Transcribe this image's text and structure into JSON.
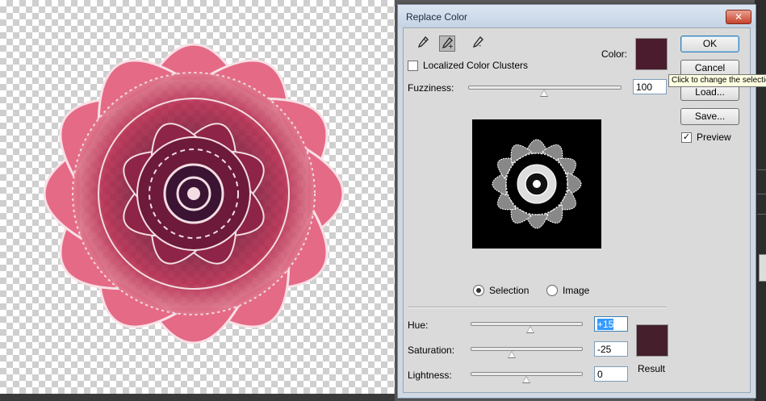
{
  "dialog": {
    "title": "Replace Color",
    "close_glyph": "✕",
    "tools": [
      "eyedropper-icon",
      "eyedropper-plus-icon",
      "eyedropper-minus-icon"
    ],
    "localized_label": "Localized Color Clusters",
    "localized_checked": false,
    "color_label": "Color:",
    "selection_color": "#4a1c2e",
    "fuzziness_label": "Fuzziness:",
    "fuzziness_value": "100",
    "fuzziness_level": 0.5,
    "view_selection_label": "Selection",
    "view_image_label": "Image",
    "view_mode": "Selection",
    "hue_label": "Hue:",
    "hue_value": "+15",
    "saturation_label": "Saturation:",
    "saturation_value": "-25",
    "lightness_label": "Lightness:",
    "lightness_value": "0",
    "result_label": "Result",
    "result_color": "#451f2c"
  },
  "buttons": {
    "ok": "OK",
    "cancel": "Cancel",
    "load": "Load...",
    "save": "Save...",
    "preview_label": "Preview",
    "preview_checked": true
  },
  "tooltip": "Click to change the selection color"
}
